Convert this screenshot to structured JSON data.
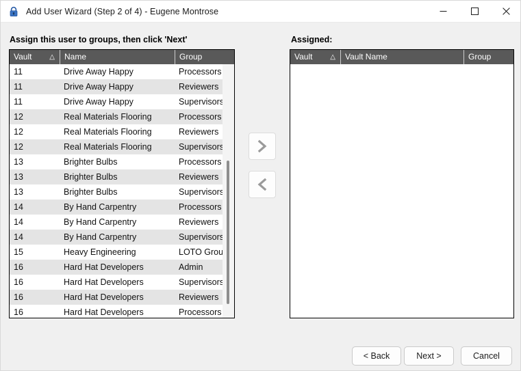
{
  "window": {
    "title": "Add User Wizard (Step 2 of 4) - Eugene Montrose",
    "icon": "padlock-icon",
    "controls": {
      "minimize": "minimize-icon",
      "maximize": "maximize-icon",
      "close": "close-icon"
    },
    "colors": {
      "titlebar_bg": "#ffffff",
      "body_bg": "#f0f0f0",
      "header_bg": "#595959",
      "header_fg": "#ffffff",
      "row_alt_bg": "#e4e4e4",
      "icon_blue": "#2d5fa8"
    }
  },
  "left": {
    "prompt": "Assign this user to groups, then click 'Next'",
    "columns": [
      "Vault",
      "Name",
      "Group"
    ],
    "sort_indicator": "△",
    "rows": [
      {
        "vault": "11",
        "name": "Drive Away Happy",
        "group": "Processors"
      },
      {
        "vault": "11",
        "name": "Drive Away Happy",
        "group": "Reviewers"
      },
      {
        "vault": "11",
        "name": "Drive Away Happy",
        "group": "Supervisors"
      },
      {
        "vault": "12",
        "name": "Real Materials Flooring",
        "group": "Processors"
      },
      {
        "vault": "12",
        "name": "Real Materials Flooring",
        "group": "Reviewers"
      },
      {
        "vault": "12",
        "name": "Real Materials Flooring",
        "group": "Supervisors"
      },
      {
        "vault": "13",
        "name": "Brighter Bulbs",
        "group": "Processors"
      },
      {
        "vault": "13",
        "name": "Brighter Bulbs",
        "group": "Reviewers"
      },
      {
        "vault": "13",
        "name": "Brighter Bulbs",
        "group": "Supervisors"
      },
      {
        "vault": "14",
        "name": "By Hand Carpentry",
        "group": "Processors"
      },
      {
        "vault": "14",
        "name": "By Hand Carpentry",
        "group": "Reviewers"
      },
      {
        "vault": "14",
        "name": "By Hand Carpentry",
        "group": "Supervisors"
      },
      {
        "vault": "15",
        "name": "Heavy Engineering",
        "group": "LOTO Group"
      },
      {
        "vault": "16",
        "name": "Hard Hat Developers",
        "group": "Admin"
      },
      {
        "vault": "16",
        "name": "Hard Hat Developers",
        "group": "Supervisors"
      },
      {
        "vault": "16",
        "name": "Hard Hat Developers",
        "group": "Reviewers"
      },
      {
        "vault": "16",
        "name": "Hard Hat Developers",
        "group": "Processors"
      }
    ]
  },
  "right": {
    "label": "Assigned:",
    "columns": [
      "Vault",
      "Vault Name",
      "Group"
    ],
    "sort_indicator": "△",
    "rows": []
  },
  "transfer": {
    "add_icon": "chevron-right-icon",
    "remove_icon": "chevron-left-icon"
  },
  "footer": {
    "back": "< Back",
    "next": "Next >",
    "cancel": "Cancel"
  }
}
